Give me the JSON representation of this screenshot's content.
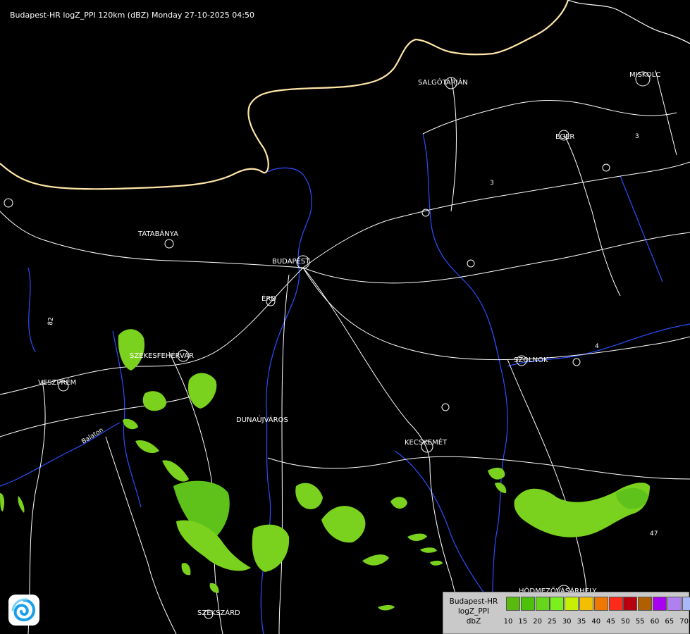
{
  "header": {
    "title": "Budapest-HR logZ_PPI 120km (dBZ) Monday 27-10-2025 04:50"
  },
  "map": {
    "city_labels": [
      "SALGÓTARJÁN",
      "MISKOLC",
      "EGER",
      "TATABÁNYA",
      "BUDAPEST",
      "ÉRD",
      "SZÉKESFEHÉRVÁR",
      "VESZPRÉM",
      "SZOLNOK",
      "DUNAÚJVÁROS",
      "KECSKEMÉT",
      "HÓDMEZŐVÁSÁRHELY",
      "SZEKSZÁRD",
      "Balaton"
    ],
    "road_labels": [
      "3",
      "3",
      "82",
      "47",
      "4"
    ],
    "colors": {
      "border": "#ffe6a8",
      "rivers": "#2a4fff",
      "roads": "#ffffff",
      "echo_light": "#7ad11e",
      "echo_mid": "#5fc21a"
    }
  },
  "legend": {
    "title_lines": [
      "Budapest-HR",
      "logZ_PPI",
      "dbZ"
    ],
    "levels": [
      "10",
      "15",
      "20",
      "25",
      "30",
      "35",
      "40",
      "45",
      "50",
      "55",
      "60",
      "65",
      "70"
    ],
    "colors": [
      "#59b90e",
      "#4cc10a",
      "#66d61a",
      "#7cf01c",
      "#c6f000",
      "#f2c000",
      "#f07800",
      "#ff2a1a",
      "#b8000e",
      "#b06000",
      "#a800f0",
      "#b080f0",
      "#a8b8f8"
    ]
  },
  "logo": {
    "icon": "weather-swirl-logo-icon"
  }
}
